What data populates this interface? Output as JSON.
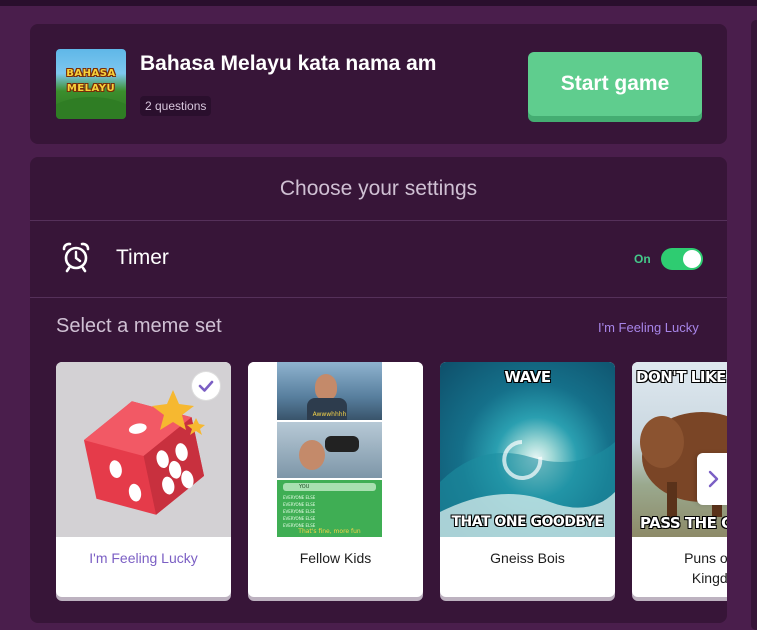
{
  "game": {
    "title": "Bahasa Melayu kata nama am",
    "question_count": "2 questions",
    "thumbnail_text_line1": "BAHASA",
    "thumbnail_text_line2": "MELAYU",
    "start_label": "Start game"
  },
  "settings": {
    "heading": "Choose your settings",
    "timer": {
      "label": "Timer",
      "state_label": "On",
      "enabled": true,
      "icon": "alarm-clock-icon"
    }
  },
  "meme_sets": {
    "heading": "Select a meme set",
    "lucky_link": "I'm Feeling Lucky",
    "items": [
      {
        "label": "I'm Feeling Lucky",
        "selected": true,
        "icon": "dice-icon"
      },
      {
        "label": "Fellow Kids",
        "selected": false,
        "overlay_top": "",
        "caption_mid": "Awwwhhhh",
        "list_header": "YOU",
        "list_rows": [
          "EVERYONE ELSE",
          "EVERYONE ELSE",
          "EVERYONE ELSE",
          "EVERYONE ELSE",
          "EVERYONE ELSE"
        ],
        "bottom_caption": "That's fine, more fun"
      },
      {
        "label": "Gneiss Bois",
        "selected": false,
        "overlay_top": "WAVE",
        "overlay_bottom": "THAT ONE GOODBYE"
      },
      {
        "label": "Puns of the\nKingdom",
        "selected": false,
        "overlay_top": "DON'T LIKE T",
        "overlay_bottom": "PASS THE C"
      }
    ],
    "next_icon": "chevron-right-icon"
  },
  "colors": {
    "background": "#4a1e4c",
    "card": "#371538",
    "accent_green": "#5fcd8e",
    "toggle_green": "#2ecc71",
    "link_purple": "#a785e8"
  }
}
